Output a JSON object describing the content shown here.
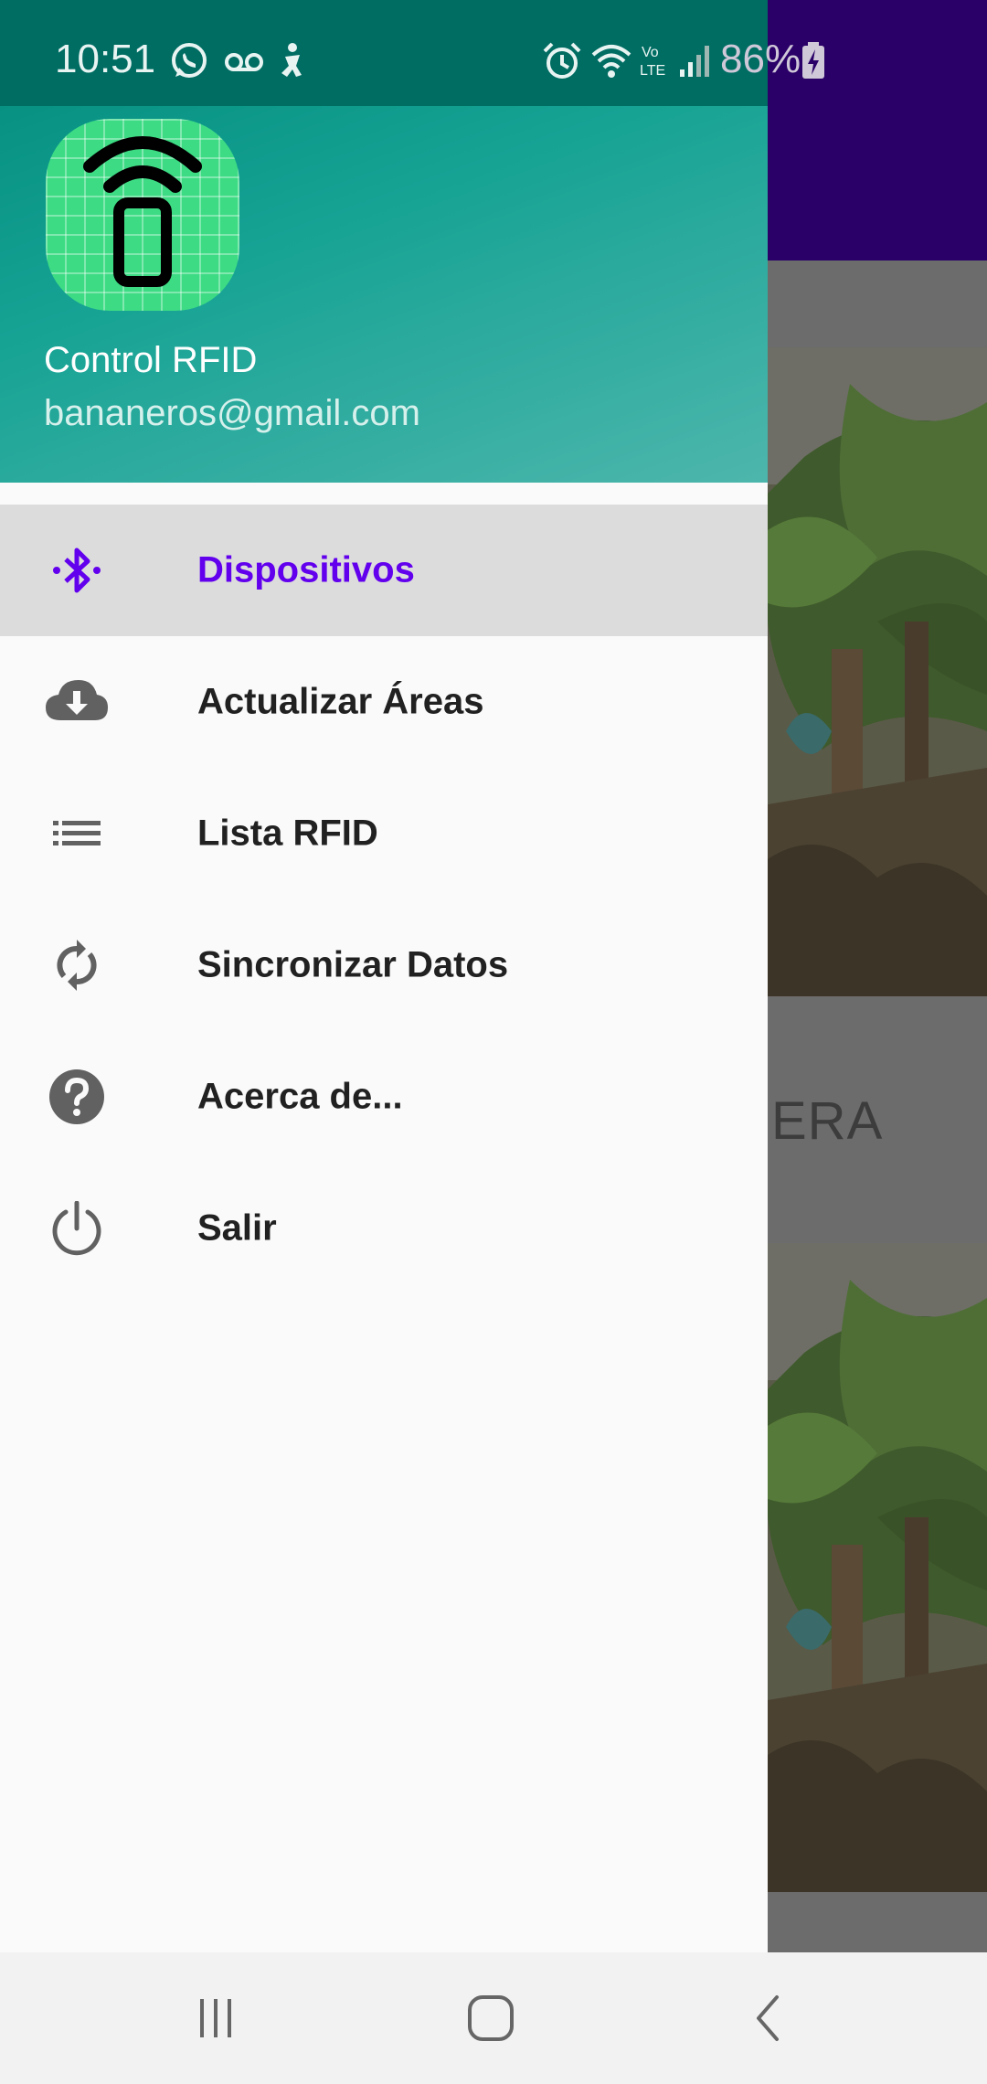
{
  "status_bar": {
    "time": "10:51",
    "battery_text": "86%",
    "left_icons": [
      "whatsapp-icon",
      "voicemail-icon",
      "accessibility-icon"
    ],
    "right_icons": [
      "alarm-icon",
      "wifi-icon",
      "volte-icon",
      "signal-icon",
      "battery-charging-icon"
    ]
  },
  "drawer": {
    "header": {
      "app_name": "Control RFID",
      "email": "bananeros@gmail.com",
      "logo_icon": "rfid-phone-icon"
    },
    "items": [
      {
        "label": "Dispositivos",
        "icon": "bluetooth-icon",
        "selected": true
      },
      {
        "label": "Actualizar Áreas",
        "icon": "cloud-download-icon",
        "selected": false
      },
      {
        "label": "Lista RFID",
        "icon": "list-icon",
        "selected": false
      },
      {
        "label": "Sincronizar Datos",
        "icon": "sync-icon",
        "selected": false
      },
      {
        "label": "Acerca de...",
        "icon": "help-icon",
        "selected": false
      },
      {
        "label": "Salir",
        "icon": "power-icon",
        "selected": false
      }
    ]
  },
  "background": {
    "partial_card_title": "ERA"
  },
  "colors": {
    "header_start": "#00897b",
    "header_end": "#4db6ac",
    "accent": "#6200ee",
    "app_bar": "#2a0068",
    "icon_gray": "#616161",
    "selected_bg": "#dcdcdc"
  },
  "nav_bar": {
    "buttons": [
      "recent-apps-icon",
      "home-icon",
      "back-icon"
    ]
  }
}
